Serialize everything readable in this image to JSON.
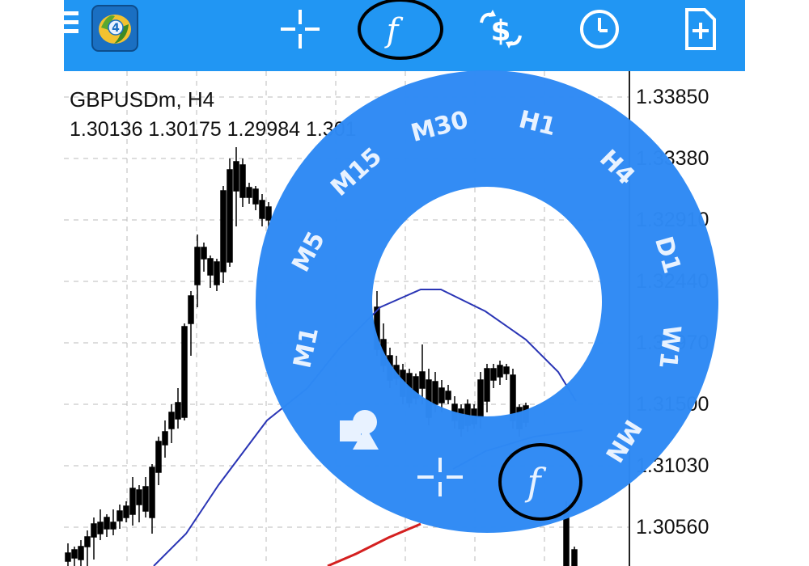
{
  "toolbar": {
    "menu_icon": "hamburger-menu-icon",
    "app_icon": "metatrader-4-logo",
    "crosshair_icon": "crosshair-icon",
    "indicators_icon": "indicators-f-icon",
    "trade_icon": "trade-dollar-icon",
    "history_icon": "clock-icon",
    "new_order_icon": "new-document-plus-icon",
    "logo_badge": "4"
  },
  "chart": {
    "symbol_title": "GBPUSDm, H4",
    "ohlc": "1.30136 1.30175 1.29984 1.301",
    "price_labels": [
      "1.33850",
      "1.33380",
      "1.32910",
      "1.32440",
      "1.31970",
      "1.31500",
      "1.31030",
      "1.30560"
    ]
  },
  "radial_menu": {
    "timeframes": [
      "M1",
      "M5",
      "M15",
      "M30",
      "H1",
      "H4",
      "D1",
      "W1",
      "MN"
    ],
    "objects_icon": "shapes-objects-icon",
    "crosshair_icon": "crosshair-icon",
    "indicators_icon": "indicators-f-icon",
    "indicators_glyph": "f"
  },
  "colors": {
    "accent": "#2196f3",
    "ring": "#2f8af4",
    "ma_fast": "#2a35b5",
    "ma_slow": "#d42020",
    "annotation_circle": "#000000"
  }
}
